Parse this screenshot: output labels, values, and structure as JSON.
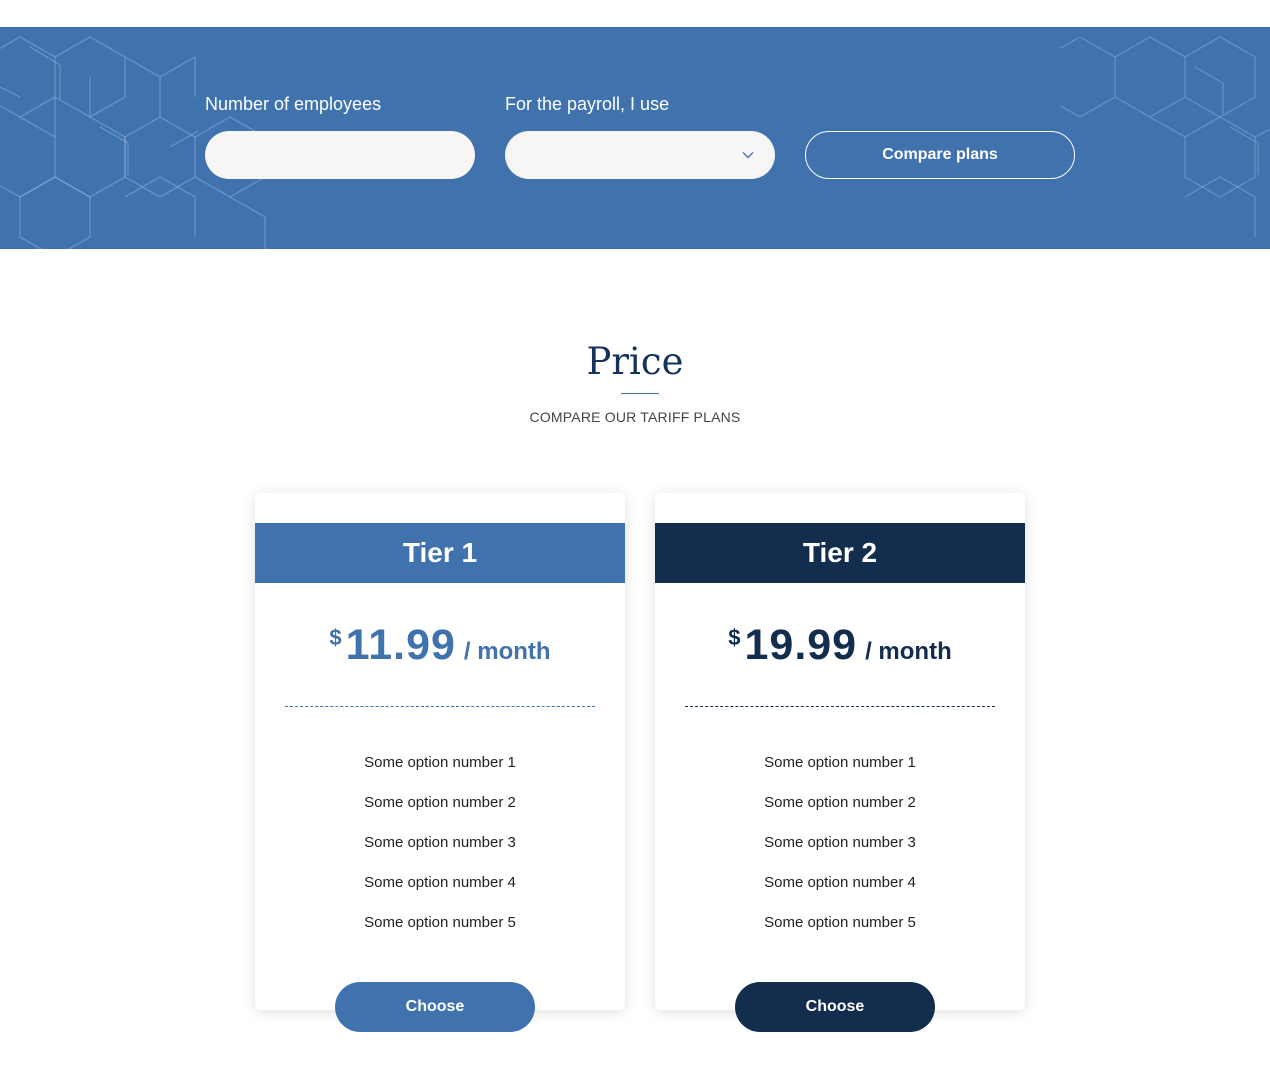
{
  "filters": {
    "employees_label": "Number of employees",
    "employees_value": "",
    "payroll_label": "For the payroll, I use",
    "payroll_value": "",
    "compare_button": "Compare plans"
  },
  "section": {
    "title": "Price",
    "subtitle": "COMPARE OUR TARIFF PLANS"
  },
  "plans": [
    {
      "name": "Tier 1",
      "currency": "$",
      "amount": "11.99",
      "period": "/ month",
      "accent_color": "#4072ae",
      "options": [
        "Some option number 1",
        "Some option number 2",
        "Some option number 3",
        "Some option number 4",
        "Some option number 5"
      ],
      "button": "Choose"
    },
    {
      "name": "Tier 2",
      "currency": "$",
      "amount": "19.99",
      "period": "/ month",
      "accent_color": "#132d4f",
      "options": [
        "Some option number 1",
        "Some option number 2",
        "Some option number 3",
        "Some option number 4",
        "Some option number 5"
      ],
      "button": "Choose"
    }
  ],
  "colors": {
    "banner": "#4072ae",
    "title": "#15325a"
  },
  "icons": {
    "select_chevron": "chevron-down-icon",
    "banner_pattern": "hexagon-pattern"
  }
}
